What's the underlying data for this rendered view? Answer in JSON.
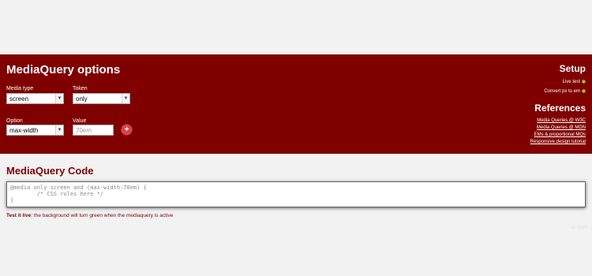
{
  "header": {
    "title": "MediaQuery options"
  },
  "options": {
    "media_type_label": "Media type",
    "media_type_value": "screen",
    "token_label": "Token",
    "token_value": "only",
    "option_label": "Option",
    "option_value": "max-width",
    "value_label": "Value",
    "value_placeholder": "70em",
    "add_label": "+"
  },
  "setup": {
    "title": "Setup",
    "items": [
      {
        "label": "Live test",
        "checked": true
      },
      {
        "label": "Convert px to em",
        "checked": true
      }
    ]
  },
  "references": {
    "title": "References",
    "links": [
      "Media Queries @ W3C",
      "Media Queries @ MDN",
      "EMs & proportional MQs",
      "Responsive design tutorial"
    ]
  },
  "code": {
    "title": "MediaQuery Code",
    "lines": [
      "@media only screen and (max-width:70em) {",
      "        /* CSS rules here */",
      "}"
    ]
  },
  "live_note": {
    "strong": "Test it live",
    "text": ": the background will turn green when the mediaquery is active"
  },
  "corner_note": "by XXXX",
  "colors": {
    "banner": "#800000",
    "accent": "#d9444b",
    "check": "#b5c93a"
  }
}
